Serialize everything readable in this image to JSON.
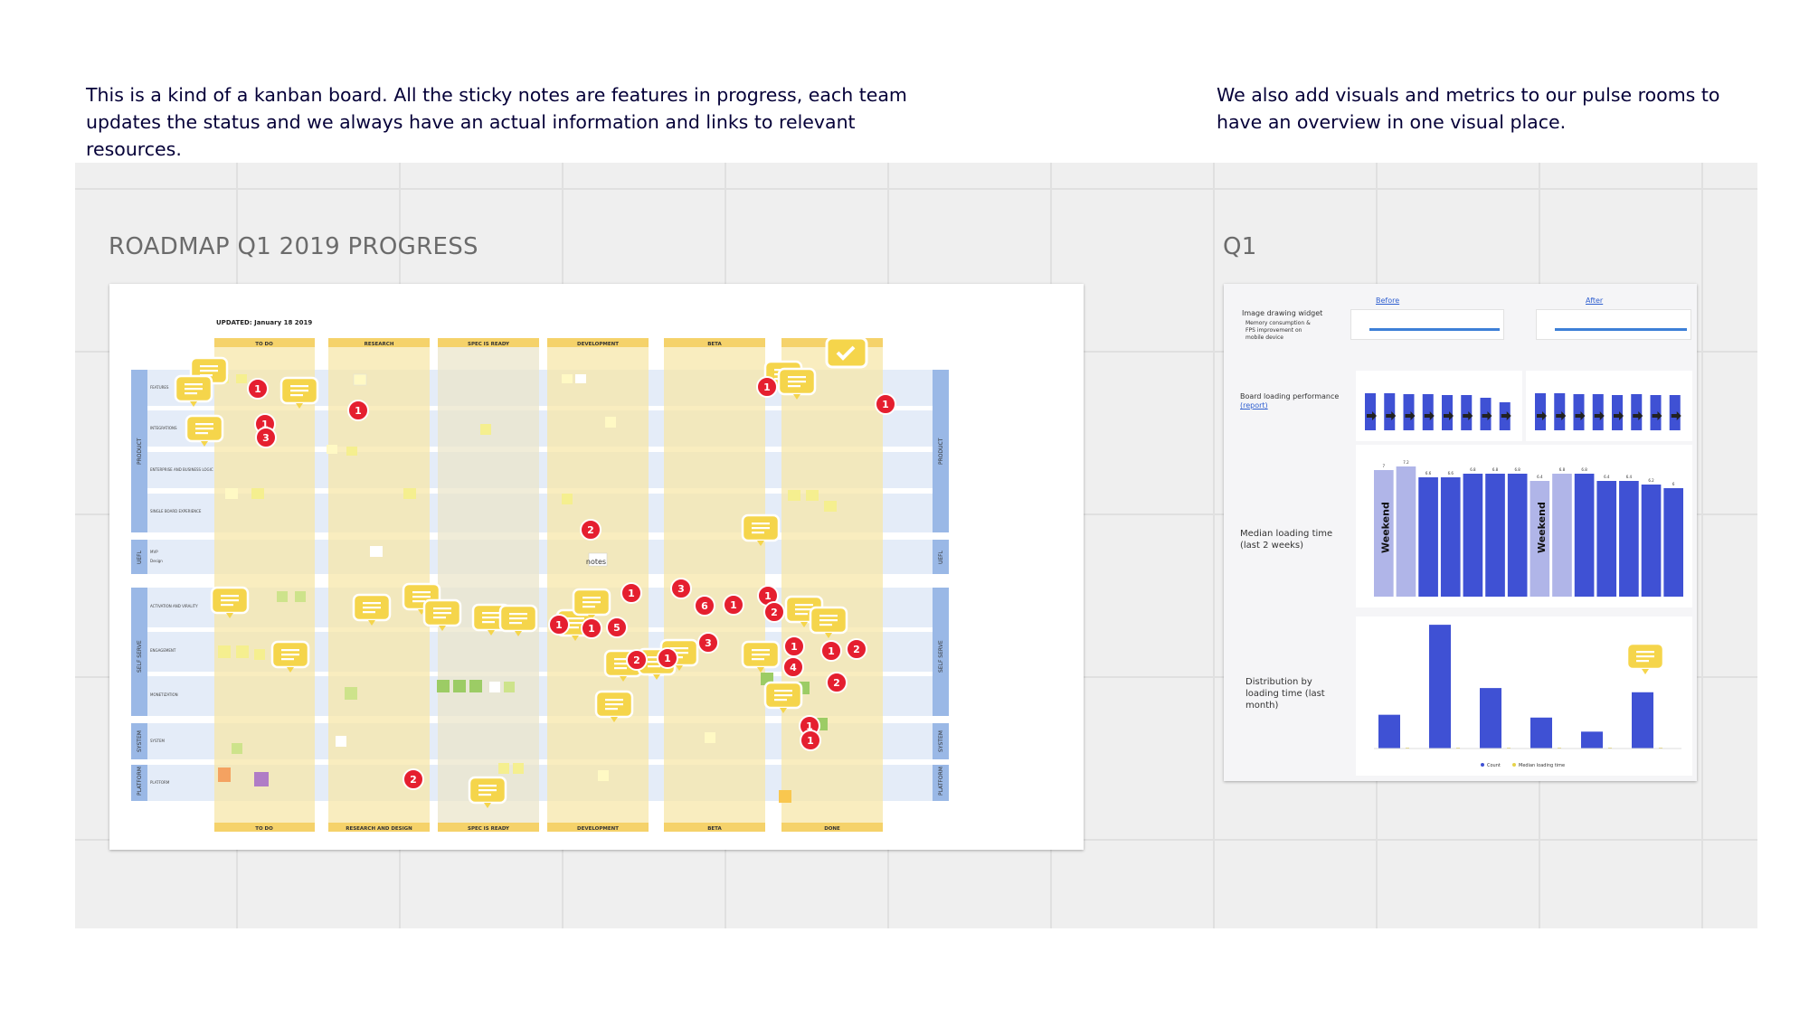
{
  "intro": {
    "left": "This is a kind of a kanban board. All the sticky notes are features in progress, each team updates the status and we always have an actual information and links to relevant resources.",
    "right": "We also add visuals and metrics to our pulse rooms to have an overview in one  visual place."
  },
  "frames": {
    "left_title": "ROADMAP Q1 2019 PROGRESS",
    "right_title": "Q1"
  },
  "board": {
    "updated": "UPDATED: January 18 2019",
    "columns_top": [
      "TO DO",
      "RESEARCH",
      "SPEC IS READY",
      "DEVELOPMENT",
      "BETA",
      ""
    ],
    "columns_bottom": [
      "TO DO",
      "RESEARCH AND DESIGN",
      "SPEC IS READY",
      "DEVELOPMENT",
      "BETA",
      "DONE"
    ],
    "groups": [
      "PRODUCT",
      "UEFL",
      "SELF SERVE",
      "SYSTEM",
      "PLATFORM"
    ],
    "rows": [
      "FEATURES",
      "INTEGRATIONS",
      "ENTERPRISE AND BUSINESS LOGIC",
      "SINGLE BOARD EXPERIENCE",
      "MVP",
      "Design",
      "ACTIVATION AND VIRALITY",
      "ENGAGEMENT",
      "MONETIZATION",
      "SYSTEM",
      "PLATFORM"
    ],
    "notes_label": "notes",
    "comment_counts": [
      "1",
      "1",
      "3",
      "1",
      "2",
      "1",
      "1",
      "3",
      "6",
      "5",
      "1",
      "1",
      "3",
      "1",
      "2",
      "1",
      "1",
      "1",
      "1",
      "4",
      "2",
      "2",
      "1",
      "2",
      "2"
    ]
  },
  "metrics": {
    "before_link": "Before",
    "after_link": "After",
    "image_drawing_label": "Image drawing widget",
    "image_drawing_sub": "Memory consumption & FPS improvement on mobile device",
    "board_loading_label": "Board loading performance",
    "report_link": "(report)",
    "median_label": "Median loading time (last 2 weeks)",
    "distribution_label": "Distribution by loading time (last month)",
    "weekend_label": "Weekend",
    "legend_count": "Count",
    "legend_median": "Median loading time"
  },
  "chart_data": [
    {
      "type": "bar",
      "title": "Median loading time (last 2 weeks)",
      "series": [
        {
          "values": [
            7.0,
            7.2,
            6.6,
            6.6,
            6.8,
            6.8,
            6.8,
            6.4,
            6.8,
            6.8,
            6.4,
            6.4,
            6.2,
            6.0
          ]
        }
      ],
      "highlight": "Weekend",
      "ylim": [
        0,
        8
      ]
    },
    {
      "type": "bar",
      "title": "Distribution by loading time (last month)",
      "series": [
        {
          "name": "Count",
          "values": [
            120000,
            440000,
            215000,
            110000,
            60000,
            200000
          ]
        }
      ],
      "ylim": [
        0,
        450000
      ]
    }
  ]
}
